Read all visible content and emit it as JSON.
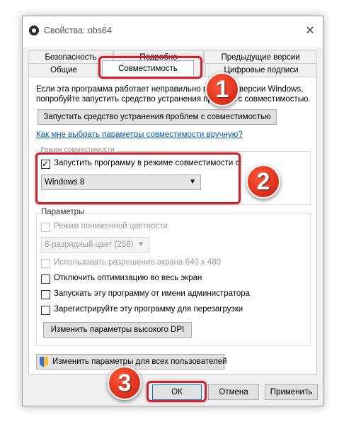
{
  "window": {
    "title": "Свойства: obs64",
    "close_glyph": "✕"
  },
  "tabs": {
    "row1": [
      "Безопасность",
      "Подробно",
      "Предыдущие версии"
    ],
    "row2": [
      "Общие",
      "Совместимость",
      "Цифровые подписи"
    ],
    "active": "Совместимость"
  },
  "compat": {
    "intro_line1": "Если эта программа работает неправильно в данной версии Windows,",
    "intro_line2": "попробуйте запустить средство устранения проблем с совместимостью.",
    "troubleshoot_button": "Запустить средство устранения проблем с совместимостью",
    "manual_link": "Как мне выбрать параметры совместимости вручную?",
    "mode_group_title": "Режим совместимости",
    "mode_checkbox_label": "Запустить программу в режиме совместимости с:",
    "mode_checked": true,
    "mode_select_value": "Windows 8"
  },
  "params": {
    "title": "Параметры",
    "reduced_color_label": "Режим пониженной цветности",
    "color_select_value": "8-разрядный цвет (256)",
    "resolution_label": "Использовать разрешение экрана 640 x 480",
    "fullscreen_label": "Отключить оптимизацию во весь экран",
    "admin_label": "Запускать эту программу от имени администратора",
    "register_label": "Зарегистрируйте эту программу для перезагрузки",
    "dpi_button": "Изменить параметры высокого DPI"
  },
  "all_users_button": "Изменить параметры для всех пользователей",
  "footer": {
    "ok": "ОК",
    "cancel": "Отмена",
    "apply": "Применить"
  },
  "markers": [
    "1",
    "2",
    "3"
  ],
  "colors": {
    "highlight_red": "#d3202a",
    "link_blue": "#0a58b8"
  }
}
